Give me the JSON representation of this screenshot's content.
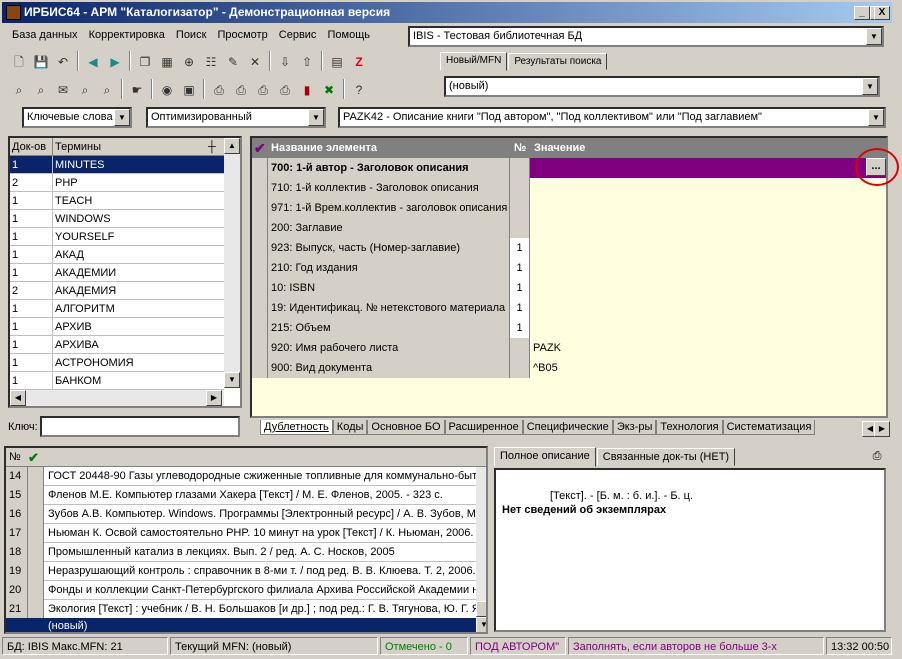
{
  "window": {
    "title": "ИРБИС64 - АРМ \"Каталогизатор\" - Демонстрационная версия",
    "min_glyph": "_",
    "max_glyph": "□",
    "close_glyph": "X"
  },
  "menu": [
    "База данных",
    "Корректировка",
    "Поиск",
    "Просмотр",
    "Сервис",
    "Помощь"
  ],
  "database_combo": {
    "value": "IBIS - Тестовая библиотечная БД"
  },
  "mfn_tabs": [
    "Новый/MFN",
    "Результаты поиска"
  ],
  "mfn_combo": {
    "value": "(новый)"
  },
  "toolbar_icons": {
    "row1": [
      "new-doc-icon",
      "save-icon",
      "undo-icon",
      "back-icon",
      "forward-icon",
      "copy-icon",
      "grid-icon",
      "globe-icon",
      "tree-icon",
      "edit-icon",
      "delete-icon",
      "import-icon",
      "export-icon",
      "dict-icon",
      "z-icon"
    ],
    "row2": [
      "search-icon",
      "search2-icon",
      "search3-icon",
      "search4-icon",
      "search5-icon",
      "hand-icon",
      "view-icon",
      "view2-icon",
      "print-icon",
      "print2-icon",
      "print3-icon",
      "print4-icon",
      "stats-icon",
      "excel-icon",
      "help-icon"
    ]
  },
  "search_type_combo": {
    "value": "Ключевые слова"
  },
  "optimization_combo": {
    "value": "Оптимизированный"
  },
  "worksheet_combo": {
    "value": "PAZK42 - Описание книги \"Под автором\", \"Под коллективом\" или \"Под заглавием\""
  },
  "dictionary": {
    "headers": {
      "count": "Док-ов",
      "term": "Термины"
    },
    "rows": [
      {
        "count": "1",
        "term": "MINUTES"
      },
      {
        "count": "2",
        "term": "PHP"
      },
      {
        "count": "1",
        "term": "TEACH"
      },
      {
        "count": "1",
        "term": "WINDOWS"
      },
      {
        "count": "1",
        "term": "YOURSELF"
      },
      {
        "count": "1",
        "term": "АКАД"
      },
      {
        "count": "1",
        "term": "АКАДЕМИИ"
      },
      {
        "count": "2",
        "term": "АКАДЕМИЯ"
      },
      {
        "count": "1",
        "term": "АЛГОРИТМ"
      },
      {
        "count": "1",
        "term": "АРХИВ"
      },
      {
        "count": "1",
        "term": "АРХИВА"
      },
      {
        "count": "1",
        "term": "АСТРОНОМИЯ"
      },
      {
        "count": "1",
        "term": "БАНКОМ"
      }
    ],
    "key_label": "Ключ:"
  },
  "fields": {
    "headers": {
      "name": "Название элемента",
      "num": "№",
      "value": "Значение"
    },
    "rows": [
      {
        "name": "700: 1-й  автор - Заголовок описания",
        "num": "",
        "value": ""
      },
      {
        "name": "710: 1-й коллектив - Заголовок описания",
        "num": "",
        "value": ""
      },
      {
        "name": "971: 1-й Врем.коллектив - заголовок описания",
        "num": "",
        "value": ""
      },
      {
        "name": "200: Заглавие",
        "num": "",
        "value": ""
      },
      {
        "name": "923: Выпуск, часть (Номер-заглавие)",
        "num": "1",
        "value": ""
      },
      {
        "name": "210: Год издания",
        "num": "1",
        "value": ""
      },
      {
        "name": "10: ISBN",
        "num": "1",
        "value": ""
      },
      {
        "name": "19: Идентификац. № нетекстового материала",
        "num": "1",
        "value": ""
      },
      {
        "name": "215: Объем",
        "num": "1",
        "value": ""
      },
      {
        "name": "920: Имя рабочего листа",
        "num": "",
        "value": "PAZK"
      },
      {
        "name": "900: Вид документа",
        "num": "",
        "value": "^B05"
      }
    ],
    "ellipsis": "..."
  },
  "worksheet_tabs": [
    "Дублетность",
    "Коды",
    "Основное БО",
    "Расширенное",
    "Специфические",
    "Экз-ры",
    "Технология",
    "Систематизация"
  ],
  "records": {
    "header_num": "№",
    "rows": [
      {
        "n": "14",
        "text": "ГОСТ 20448-90 Газы углеводородные сжиженные топливные для коммунально-бытового потребления"
      },
      {
        "n": "15",
        "text": "Фленов М.Е. Компьютер глазами Хакера [Текст] / М. Е. Фленов, 2005. - 323 с."
      },
      {
        "n": "16",
        "text": "Зубов А.В. Компьютер. Windows. Программы [Электронный ресурс] / А. В. Зубов, М."
      },
      {
        "n": "17",
        "text": "Ньюман К. Освой самостоятельно PHP. 10 минут на урок [Текст] / К. Ньюман, 2006."
      },
      {
        "n": "18",
        "text": "Промышленный катализ в лекциях. Вып. 2 / ред. А. С. Носков, 2005"
      },
      {
        "n": "19",
        "text": "Неразрушающий контроль : справочник в 8-ми т. / под ред. В. В. Клюева. Т. 2, 2006."
      },
      {
        "n": "20",
        "text": "Фонды и коллекции Санкт-Петербургского филиала Архива Российской Академии наук"
      },
      {
        "n": "21",
        "text": "Экология [Текст] : учебник / В. Н. Большаков [и др.] ; под ред.: Г. В. Тягунова, Ю. Г. Я"
      }
    ],
    "new_row": "(новый)"
  },
  "preview_tabs": [
    "Полное описание",
    "Связанные док-ты (НЕТ)"
  ],
  "preview": {
    "line1": "[Текст]. - [Б. м. : б. и.]. - Б. ц.",
    "line2": "Нет сведений об экземплярах"
  },
  "status": {
    "db": "БД: IBIS Макс.MFN: 21",
    "current": "Текущий MFN: (новый)",
    "marked": "Отмечено - 0",
    "mode": "ПОД АВТОРОМ\"",
    "hint": "Заполнять, если авторов не больше 3-х",
    "time": "13:32  00:50"
  },
  "colors": {
    "selected_row": "#0a246a",
    "field_selected": "#800080",
    "value_bg": "#ffffe0",
    "marked_text": "#008000",
    "mode_text": "#800080",
    "highlight_circle": "#e00000"
  }
}
